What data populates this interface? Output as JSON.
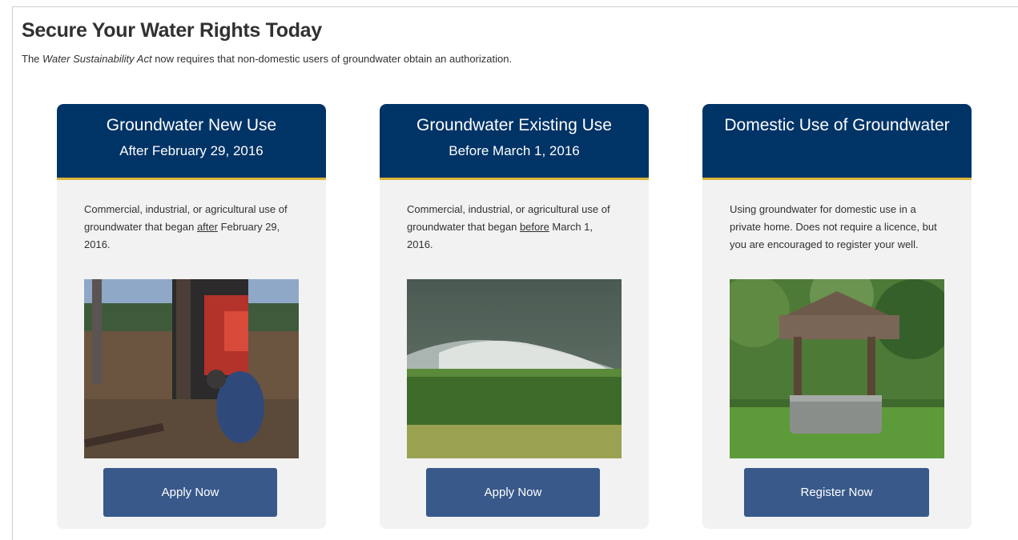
{
  "page": {
    "title": "Secure Your Water Rights Today",
    "intro_prefix": "The ",
    "intro_act": "Water Sustainability Act",
    "intro_suffix": " now requires that non-domestic users of groundwater obtain an authorization."
  },
  "cards": [
    {
      "title": "Groundwater New Use",
      "subtitle": "After February 29, 2016",
      "desc_before": "Commercial, industrial, or agricultural use of groundwater that began ",
      "desc_underlined": "after",
      "desc_after": " February 29, 2016.",
      "image": "drilling-rig-photo",
      "button": "Apply Now"
    },
    {
      "title": "Groundwater Existing Use",
      "subtitle": "Before March 1, 2016",
      "desc_before": "Commercial, industrial, or agricultural use of groundwater that began ",
      "desc_underlined": "before",
      "desc_after": " March 1, 2016.",
      "image": "irrigation-field-photo",
      "button": "Apply Now"
    },
    {
      "title": "Domestic Use of Groundwater",
      "subtitle": "",
      "desc": "Using groundwater for domestic use in a private home. Does not require a licence, but you are encouraged to register your well.",
      "image": "water-well-photo",
      "button": "Register Now"
    }
  ],
  "colors": {
    "header_bg": "#003366",
    "header_accent": "#d8b53a",
    "button_bg": "#38598a",
    "card_bg": "#f2f2f2"
  }
}
